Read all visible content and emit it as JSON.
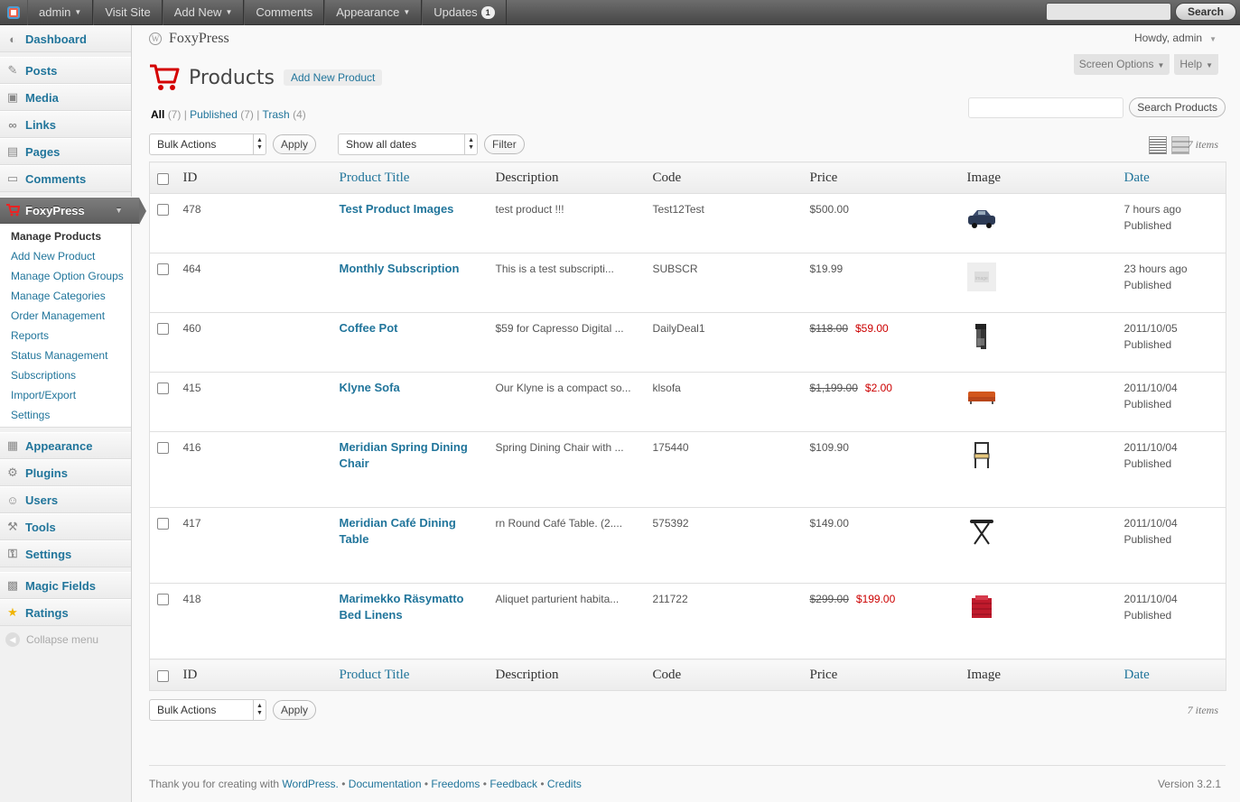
{
  "adminbar": {
    "items": [
      {
        "label": "admin",
        "caret": true
      },
      {
        "label": "Visit Site",
        "caret": false
      },
      {
        "label": "Add New",
        "caret": true
      },
      {
        "label": "Comments",
        "caret": false
      },
      {
        "label": "Appearance",
        "caret": true
      }
    ],
    "updates_label": "Updates",
    "updates_count": "1",
    "search_button": "Search"
  },
  "sidebar": {
    "top": [
      {
        "label": "Dashboard",
        "icon": "dashboard-icon"
      }
    ],
    "group1": [
      {
        "label": "Posts",
        "icon": "pin-icon"
      },
      {
        "label": "Media",
        "icon": "media-icon"
      },
      {
        "label": "Links",
        "icon": "link-icon"
      },
      {
        "label": "Pages",
        "icon": "page-icon"
      },
      {
        "label": "Comments",
        "icon": "comment-icon"
      }
    ],
    "current": {
      "label": "FoxyPress",
      "icon": "cart-icon"
    },
    "submenu": [
      "Manage Products",
      "Add New Product",
      "Manage Option Groups",
      "Manage Categories",
      "Order Management",
      "Reports",
      "Status Management",
      "Subscriptions",
      "Import/Export",
      "Settings"
    ],
    "group2": [
      {
        "label": "Appearance",
        "icon": "appearance-icon"
      },
      {
        "label": "Plugins",
        "icon": "plugin-icon"
      },
      {
        "label": "Users",
        "icon": "users-icon"
      },
      {
        "label": "Tools",
        "icon": "tools-icon"
      },
      {
        "label": "Settings",
        "icon": "settings-icon"
      }
    ],
    "group3": [
      {
        "label": "Magic Fields",
        "icon": "magic-fields-icon"
      },
      {
        "label": "Ratings",
        "icon": "star-icon"
      }
    ],
    "collapse": "Collapse menu"
  },
  "header": {
    "site_name": "FoxyPress",
    "howdy": "Howdy, admin",
    "screen_options": "Screen Options",
    "help": "Help"
  },
  "page": {
    "title": "Products",
    "add_new": "Add New Product",
    "filters": {
      "all": "All",
      "all_count": "(7)",
      "published": "Published",
      "published_count": "(7)",
      "trash": "Trash",
      "trash_count": "(4)",
      "sep": "|"
    },
    "search_button": "Search Products",
    "bulk_actions": "Bulk Actions",
    "apply": "Apply",
    "dates": "Show all dates",
    "filter": "Filter",
    "items_count": "7 items"
  },
  "table": {
    "columns": [
      "ID",
      "Product Title",
      "Description",
      "Code",
      "Price",
      "Image",
      "Date"
    ],
    "rows": [
      {
        "id": "478",
        "title": "Test Product Images",
        "desc": "test product !!!",
        "code": "Test12Test",
        "price": "$500.00",
        "sale": "",
        "image": "car-thumbnail",
        "date": "7 hours ago",
        "status": "Published"
      },
      {
        "id": "464",
        "title": "Monthly Subscription",
        "desc": "This is a test subscripti...",
        "code": "SUBSCR",
        "price": "$19.99",
        "sale": "",
        "image": "placeholder-thumbnail",
        "date": "23 hours ago",
        "status": "Published"
      },
      {
        "id": "460",
        "title": "Coffee Pot",
        "desc": "$59 for Capresso Digital ...",
        "code": "DailyDeal1",
        "price": "$118.00",
        "sale": "$59.00",
        "image": "coffee-maker-thumbnail",
        "date": "2011/10/05",
        "status": "Published"
      },
      {
        "id": "415",
        "title": "Klyne Sofa",
        "desc": "Our Klyne is a compact so...",
        "code": "klsofa",
        "price": "$1,199.00",
        "sale": "$2.00",
        "image": "sofa-thumbnail",
        "date": "2011/10/04",
        "status": "Published"
      },
      {
        "id": "416",
        "title": "Meridian Spring Dining Chair",
        "desc": "Spring Dining Chair with ...",
        "code": "175440",
        "price": "$109.90",
        "sale": "",
        "image": "chair-thumbnail",
        "date": "2011/10/04",
        "status": "Published"
      },
      {
        "id": "417",
        "title": "Meridian Café Dining Table",
        "desc": "rn Round Café Table. (2....",
        "code": "575392",
        "price": "$149.00",
        "sale": "",
        "image": "table-thumbnail",
        "date": "2011/10/04",
        "status": "Published"
      },
      {
        "id": "418",
        "title": "Marimekko Räsymatto Bed Linens",
        "desc": "Aliquet parturient habita...",
        "code": "211722",
        "price": "$299.00",
        "sale": "$199.00",
        "image": "bed-linens-thumbnail",
        "date": "2011/10/04",
        "status": "Published"
      }
    ]
  },
  "footer": {
    "thanks": "Thank you for creating with",
    "wordpress": "WordPress.",
    "links": [
      "Documentation",
      "Freedoms",
      "Feedback",
      "Credits"
    ],
    "sep": "•",
    "version": "Version 3.2.1"
  },
  "colors": {
    "link": "#21759b",
    "sale": "#cc0000",
    "cart": "#d40000"
  }
}
